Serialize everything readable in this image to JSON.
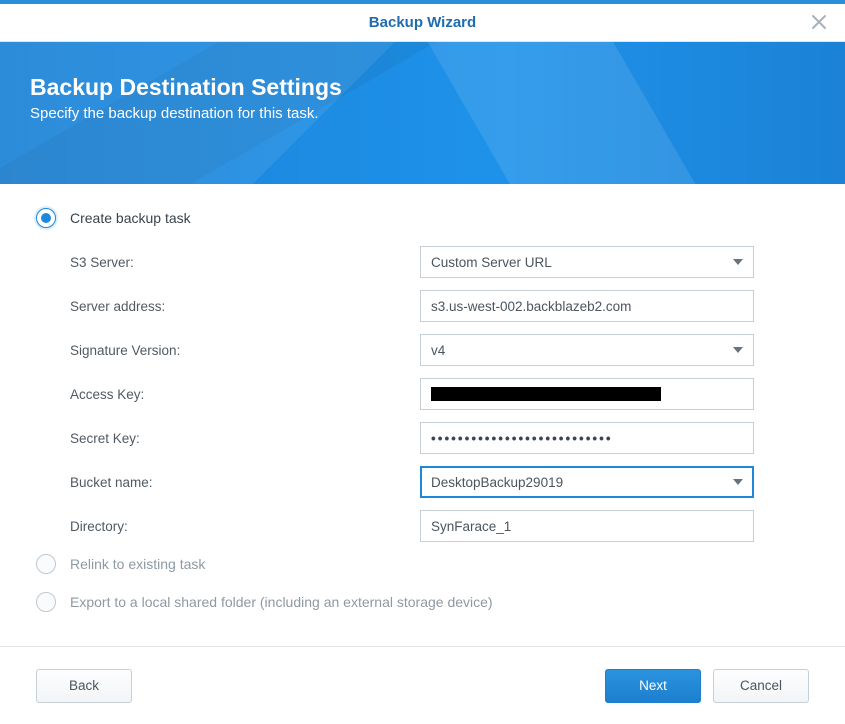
{
  "window": {
    "title": "Backup Wizard"
  },
  "banner": {
    "heading": "Backup Destination Settings",
    "subheading": "Specify the backup destination for this task."
  },
  "options": {
    "create": {
      "label": "Create backup task",
      "selected": true
    },
    "relink": {
      "label": "Relink to existing task",
      "selected": false,
      "disabled": true
    },
    "export": {
      "label": "Export to a local shared folder (including an external storage device)",
      "selected": false,
      "disabled": true
    }
  },
  "form": {
    "s3server": {
      "label": "S3 Server:",
      "value": "Custom Server URL",
      "type": "select"
    },
    "address": {
      "label": "Server address:",
      "value": "s3.us-west-002.backblazeb2.com",
      "type": "text"
    },
    "signature": {
      "label": "Signature Version:",
      "value": "v4",
      "type": "select"
    },
    "accesskey": {
      "label": "Access Key:",
      "value": "",
      "type": "redacted"
    },
    "secretkey": {
      "label": "Secret Key:",
      "value": "•••••••••••••••••••••••••••",
      "type": "password"
    },
    "bucket": {
      "label": "Bucket name:",
      "value": "DesktopBackup29019",
      "type": "select",
      "focused": true
    },
    "directory": {
      "label": "Directory:",
      "value": "SynFarace_1",
      "type": "text"
    }
  },
  "footer": {
    "back": "Back",
    "next": "Next",
    "cancel": "Cancel"
  }
}
